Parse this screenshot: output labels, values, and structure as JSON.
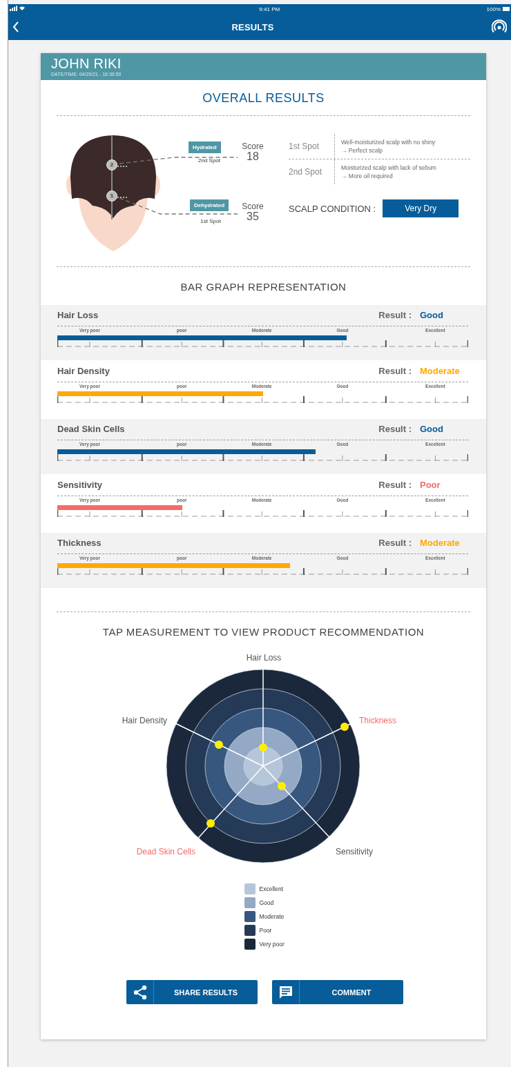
{
  "status_bar": {
    "time": "9:41 PM",
    "battery": "100%"
  },
  "nav": {
    "title": "RESULTS"
  },
  "patient": {
    "name": "JOHN RIKI",
    "datetime": "DATE/TIME: 04/29/21 - 16:30:50"
  },
  "overall": {
    "title": "OVERALL RESULTS",
    "spots": [
      {
        "marker": "2",
        "tag": "Hydrated",
        "label": "2nd Spot",
        "score_label": "Score",
        "score": "18"
      },
      {
        "marker": "1",
        "tag": "Dehydrated",
        "label": "1st Spot",
        "score_label": "Score",
        "score": "35"
      }
    ],
    "spot_notes": [
      {
        "spot": "1st Spot",
        "text": "Well-moisturized scalp with no shiny",
        "note": "→ Perfect scalp"
      },
      {
        "spot": "2nd Spot",
        "text": "Moisturized scalp with lack of sebum",
        "note": "→ More oil required"
      }
    ],
    "scalp_condition": {
      "label": "SCALP CONDITION :",
      "value": "Very Dry"
    }
  },
  "bar_graph": {
    "title": "BAR GRAPH REPRESENTATION",
    "rows": [
      {
        "name": "Hair Loss",
        "result_label": "Result :",
        "result": "Good",
        "color": "#065d99",
        "level": 0.705,
        "scale": [
          "Very poor",
          "poor",
          "Moderate",
          "Good",
          "Excellent"
        ]
      },
      {
        "name": "Hair Density",
        "result_label": "Result :",
        "result": "Moderate",
        "color": "#ffa800",
        "level": 0.5,
        "scale": [
          "Very poor",
          "poor",
          "Moderate",
          "Good",
          "Excellent"
        ]
      },
      {
        "name": "Dead Skin Cells",
        "result_label": "Result :",
        "result": "Good",
        "color": "#065d99",
        "level": 0.628,
        "scale": [
          "Very poor",
          "poor",
          "Moderate",
          "Good",
          "Excellent"
        ]
      },
      {
        "name": "Sensitivity",
        "result_label": "Result :",
        "result": "Poor",
        "color": "#f66a6a",
        "level": 0.305,
        "scale": [
          "Very poor",
          "poor",
          "Moderate",
          "Good",
          "Excellent"
        ]
      },
      {
        "name": "Thickness",
        "result_label": "Result :",
        "result": "Moderate",
        "color": "#ffa800",
        "level": 0.566,
        "scale": [
          "Very poor",
          "poor",
          "Moderate",
          "Good",
          "Excellent"
        ]
      }
    ]
  },
  "radar": {
    "title": "TAP MEASUREMENT TO VIEW PRODUCT RECOMMENDATION",
    "axes": [
      {
        "label": "Hair Loss",
        "color": "#555555"
      },
      {
        "label": "Hair Density",
        "color": "#555555"
      },
      {
        "label": "Thickness",
        "color": "#f66a6a"
      },
      {
        "label": "Dead Skin Cells",
        "color": "#f66a6a"
      },
      {
        "label": "Sensitivity",
        "color": "#555555"
      }
    ],
    "legend": [
      {
        "label": "Excellent",
        "color": "#b6c6d9"
      },
      {
        "label": "Good",
        "color": "#93a9c6"
      },
      {
        "label": "Moderate",
        "color": "#37577e"
      },
      {
        "label": "Poor",
        "color": "#253a57"
      },
      {
        "label": "Very poor",
        "color": "#1b283b"
      }
    ]
  },
  "buttons": [
    {
      "kind": "share",
      "label": "SHARE RESULTS"
    },
    {
      "kind": "comment",
      "label": "COMMENT"
    }
  ]
}
